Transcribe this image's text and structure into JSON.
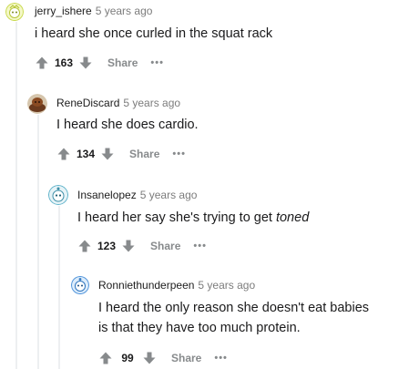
{
  "comments": [
    {
      "username": "jerry_ishere",
      "time": "5 years ago",
      "body": "i heard she once curled in the squat rack",
      "score": "163",
      "share_label": "Share",
      "more_label": "•••"
    },
    {
      "username": "ReneDiscard",
      "time": "5 years ago",
      "body": "I heard she does cardio.",
      "score": "134",
      "share_label": "Share",
      "more_label": "•••"
    },
    {
      "username": "Insanelopez",
      "time": "5 years ago",
      "body_plain": "I heard her say she's trying to get ",
      "body_em": "toned",
      "score": "123",
      "share_label": "Share",
      "more_label": "•••"
    },
    {
      "username": "Ronniethunderpeen",
      "time": "5 years ago",
      "body_line1": "I heard the only reason she doesn't eat babies",
      "body_line2": "is that they have too much protein.",
      "score": "99",
      "share_label": "Share",
      "more_label": "•••"
    }
  ],
  "icons": {
    "upvote": "upvote-arrow-icon",
    "downvote": "downvote-arrow-icon"
  },
  "colors": {
    "vote_arrow": "#878a8c",
    "thread_line": "#edeff1",
    "time": "#7c7c7c"
  }
}
